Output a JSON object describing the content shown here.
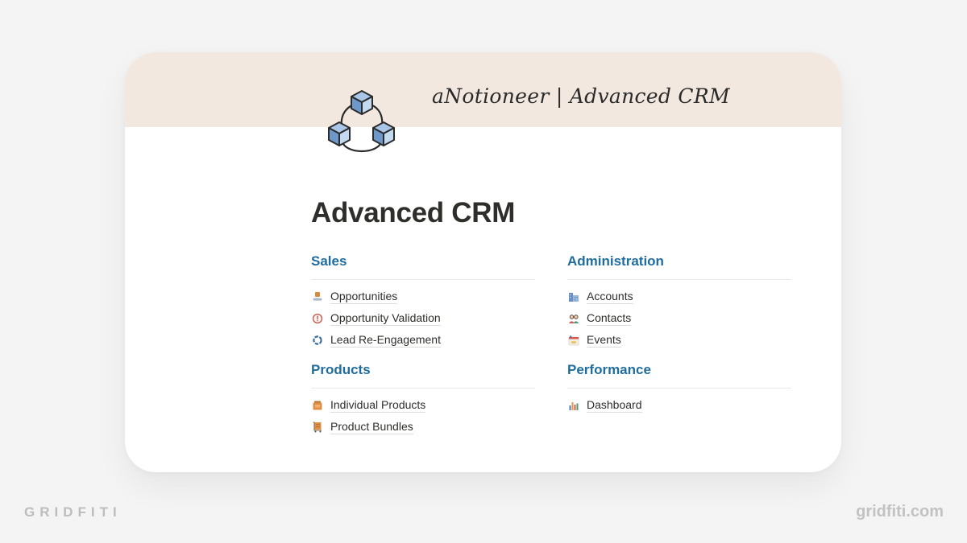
{
  "banner": {
    "title": "aNotioneer | Advanced CRM",
    "logo_icon": "connected-cubes-icon",
    "background_color": "#f3e8df"
  },
  "page": {
    "title": "Advanced CRM"
  },
  "sections": [
    {
      "heading": "Sales",
      "links": [
        {
          "label": "Opportunities",
          "icon": "handshake-icon"
        },
        {
          "label": "Opportunity Validation",
          "icon": "alert-circle-icon"
        },
        {
          "label": "Lead Re-Engagement",
          "icon": "cycle-icon"
        }
      ]
    },
    {
      "heading": "Administration",
      "links": [
        {
          "label": "Accounts",
          "icon": "buildings-icon"
        },
        {
          "label": "Contacts",
          "icon": "people-icon"
        },
        {
          "label": "Events",
          "icon": "calendar-icon"
        }
      ]
    },
    {
      "heading": "Products",
      "links": [
        {
          "label": "Individual Products",
          "icon": "package-icon"
        },
        {
          "label": "Product Bundles",
          "icon": "cart-icon"
        }
      ]
    },
    {
      "heading": "Performance",
      "links": [
        {
          "label": "Dashboard",
          "icon": "bar-chart-icon"
        }
      ]
    }
  ],
  "colors": {
    "heading": "#1f6d9f",
    "text": "#2f2e2b",
    "page_background": "#f4f4f4"
  },
  "footer": {
    "brand": "GRIDFITI",
    "url": "gridfiti.com"
  }
}
